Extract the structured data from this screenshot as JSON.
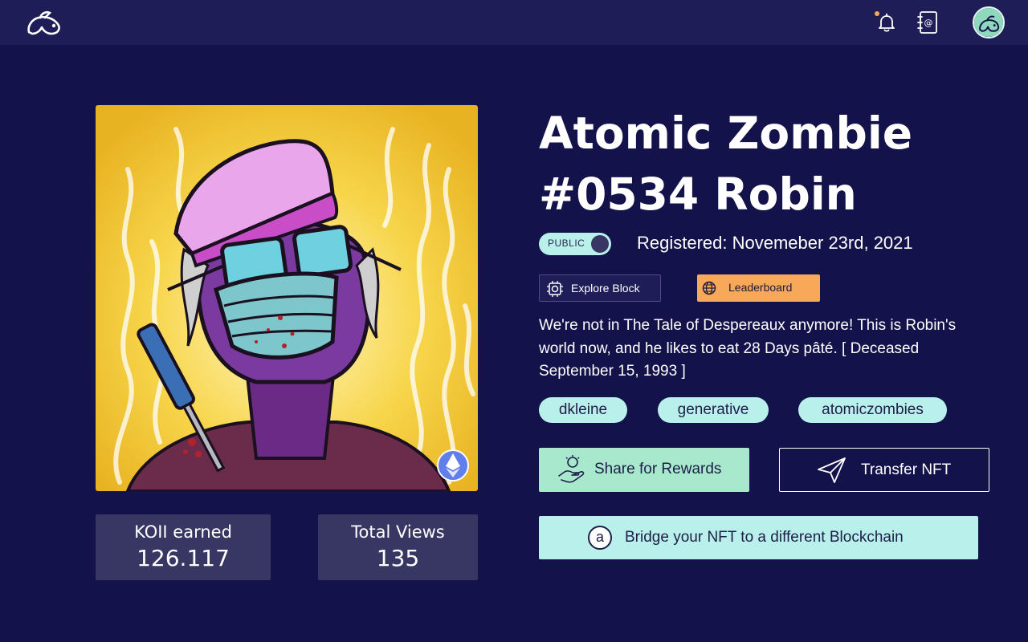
{
  "theme": {
    "background": "#14124a",
    "topbar": "#1f1d57",
    "stat_bg": "#383663",
    "accent_mint": "#a8e8cc",
    "accent_cyan": "#b9f0ec",
    "accent_orange": "#f8a859",
    "notification_dot": "#f8a859",
    "eth_badge": "#627eea"
  },
  "header": {
    "logo_icon": "koii-logo-icon",
    "notification_icon": "bell-icon",
    "contacts_icon": "address-book-icon",
    "avatar_icon": "koii-avatar-icon"
  },
  "nft": {
    "title": "Atomic Zombie #0534 Robin",
    "visibility_label": "PUBLIC",
    "registered": "Registered: Novemeber 23rd, 2021",
    "description": "We're not in The Tale of Despereaux anymore! This is Robin's world now, and he likes to eat 28 Days pâté. [ Deceased September 15, 1993 ]",
    "chain_badge_icon": "ethereum-icon",
    "tags": [
      "dkleine",
      "generative",
      "atomiczombies"
    ]
  },
  "stats": {
    "koii_label": "KOII earned",
    "koii_value": "126.117",
    "views_label": "Total Views",
    "views_value": "135"
  },
  "actions": {
    "explore_block": "Explore Block",
    "leaderboard": "Leaderboard",
    "share": "Share for Rewards",
    "transfer": "Transfer NFT",
    "bridge": "Bridge your NFT to a different Blockchain",
    "bridge_icon_letter": "a"
  }
}
